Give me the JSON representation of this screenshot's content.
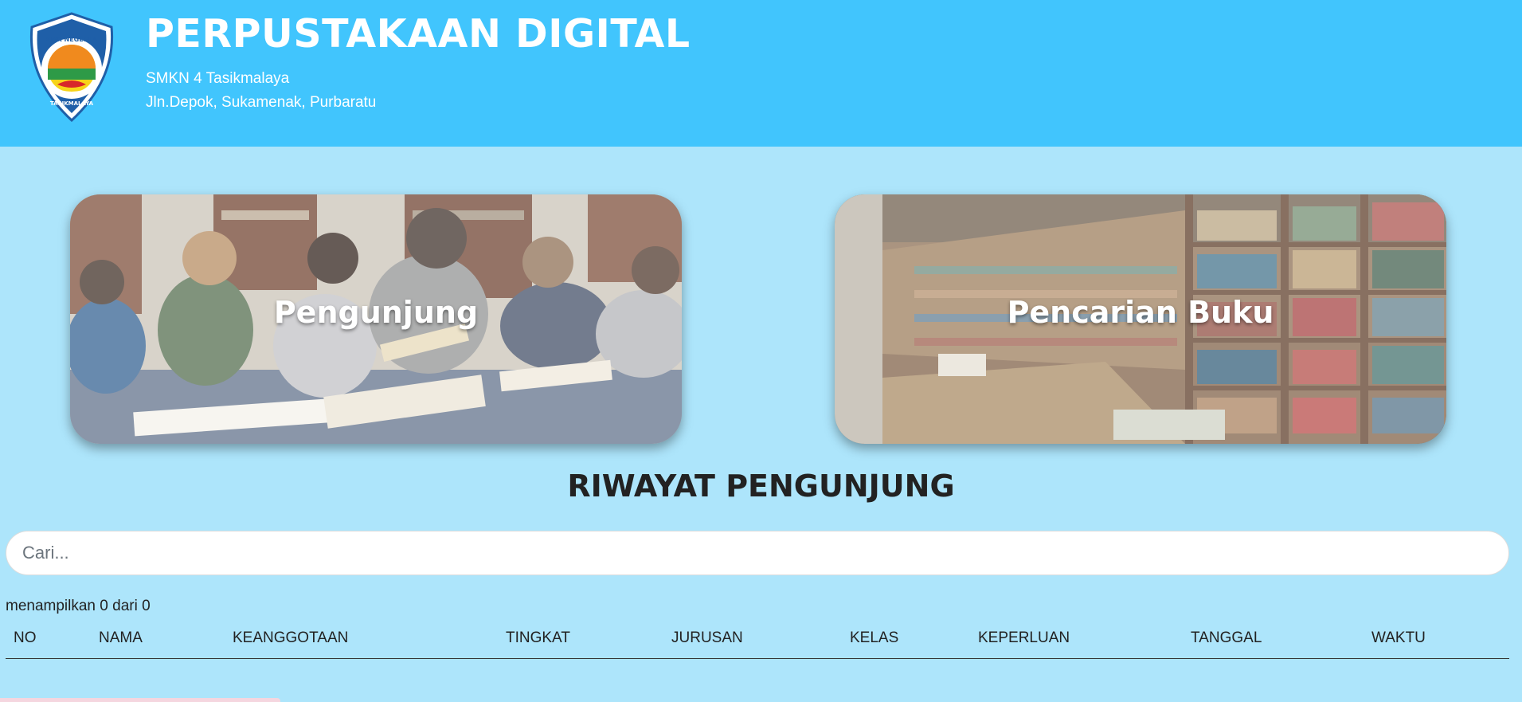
{
  "header": {
    "title": "PERPUSTAKAAN DIGITAL",
    "school": "SMKN 4 Tasikmalaya",
    "address": "Jln.Depok, Sukamenak, Purbaratu",
    "logo_top_text": "SMK NEGERI 4",
    "logo_bottom_text": "TASIKMALAYA"
  },
  "cards": {
    "visitor_label": "Pengunjung",
    "search_label": "Pencarian Buku"
  },
  "history": {
    "title": "RIWAYAT PENGUNJUNG",
    "search_placeholder": "Cari...",
    "count_text": "menampilkan 0 dari 0",
    "columns": [
      "NO",
      "NAMA",
      "KEANGGOTAAN",
      "TINGKAT",
      "JURUSAN",
      "KELAS",
      "KEPERLUAN",
      "TANGGAL",
      "WAKTU"
    ]
  },
  "colors": {
    "header_bg": "#41c5fd",
    "page_bg": "#ade5fb"
  }
}
